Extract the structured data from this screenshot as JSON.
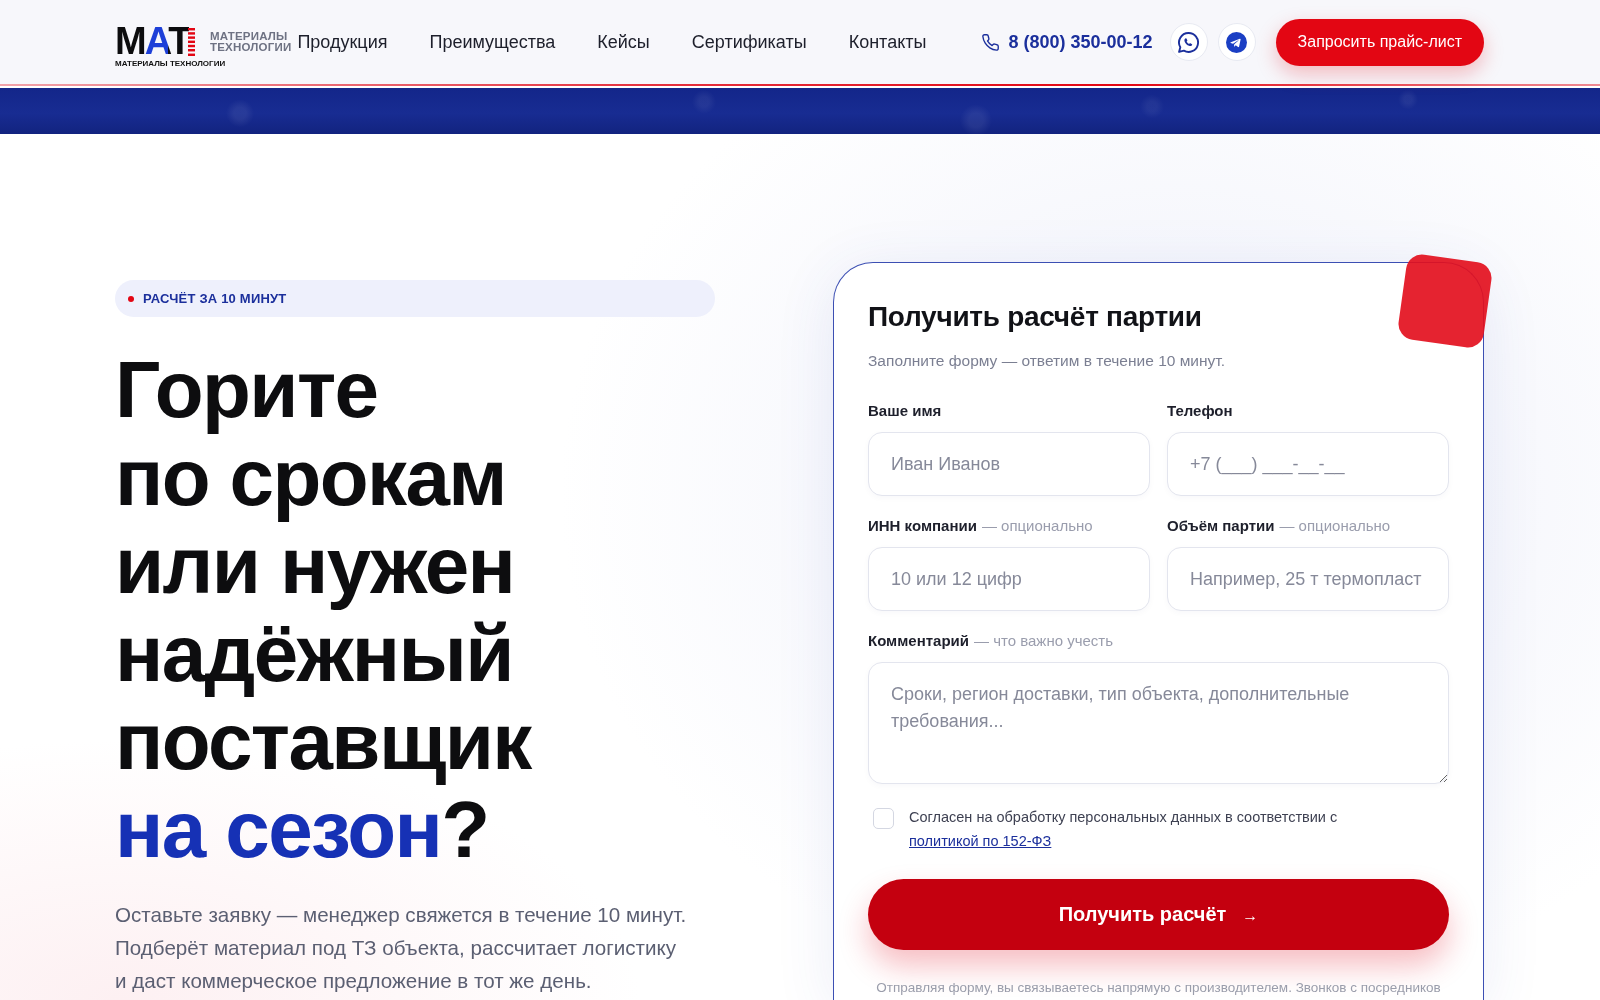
{
  "header": {
    "logo": {
      "mark": "МАТ",
      "caption": "МАТЕРИАЛЫ ТЕХНОЛОГИИ"
    },
    "company_name_lines": [
      "МАТЕРИАЛЫ",
      "ТЕХНОЛОГИИ"
    ],
    "nav": [
      "Продукция",
      "Преимущества",
      "Кейсы",
      "Сертификаты",
      "Контакты"
    ],
    "phone": "8 (800) 350-00-12",
    "cta_button": "Запросить прайс-лист"
  },
  "hero": {
    "badge": "РАСЧЁТ ЗА 10 МИНУТ",
    "headline_lines": [
      "Горите",
      "по срокам",
      "или нужен",
      "надёжный",
      "поставщик",
      "**на сезон**?"
    ],
    "lead_lines": [
      "Оставьте заявку — менеджер свяжется в течение 10 минут.",
      "Подберёт материал под ТЗ объекта, рассчитает логистику",
      "и даст коммерческое предложение в тот же день."
    ]
  },
  "form": {
    "title": "Получить расчёт партии",
    "subtitle": "Заполните форму — ответим в течение 10 минут.",
    "fields": [
      {
        "kind": "input",
        "label": "Ваше имя",
        "placeholder": "Иван Иванов"
      },
      {
        "kind": "input",
        "label": "Телефон",
        "placeholder": "+7 (___) ___-__-__"
      },
      {
        "kind": "input",
        "label": "ИНН компании",
        "hint": "— опционально",
        "placeholder": "10 или 12 цифр"
      },
      {
        "kind": "input",
        "label": "Объём партии",
        "hint": "— опционально",
        "placeholder": "Например, 25 т термопласт"
      },
      {
        "kind": "textarea",
        "label": "Комментарий",
        "hint": "— что важно учесть",
        "placeholder": "Сроки, регион доставки, тип объекта, дополнительные требования..."
      }
    ],
    "consent": {
      "checked": false,
      "text": "Согласен на обработку персональных данных в соответствии с",
      "link": "политикой по 152-ФЗ"
    },
    "submit": {
      "label": "Получить расчёт",
      "arrow": "→"
    },
    "note": "Отправляя форму, вы связываетесь напрямую с производителем. Звонков с посредников"
  }
}
